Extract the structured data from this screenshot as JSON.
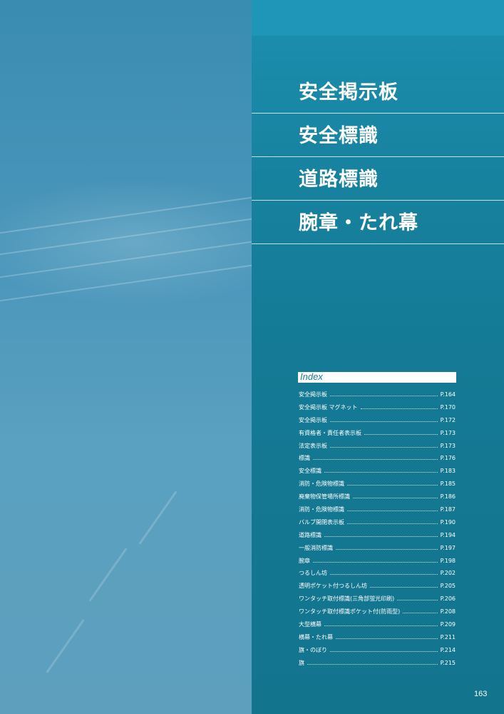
{
  "titles": [
    "安全掲示板",
    "安全標識",
    "道路標識",
    "腕章・たれ幕"
  ],
  "index": {
    "header": "Index",
    "items": [
      {
        "label": "安全掲示板",
        "page": "P.164"
      },
      {
        "label": "安全掲示板 マグネット",
        "page": "P.170"
      },
      {
        "label": "安全掲示板",
        "page": "P.172"
      },
      {
        "label": "有資格者・責任者表示板",
        "page": "P.173"
      },
      {
        "label": "法定表示板",
        "page": "P.173"
      },
      {
        "label": "標識",
        "page": "P.176"
      },
      {
        "label": "安全標識",
        "page": "P.183"
      },
      {
        "label": "消防・危険物標識",
        "page": "P.185"
      },
      {
        "label": "廃棄物保管場所標識",
        "page": "P.186"
      },
      {
        "label": "消防・危険物標識",
        "page": "P.187"
      },
      {
        "label": "バルブ開閉表示板",
        "page": "P.190"
      },
      {
        "label": "道路標識",
        "page": "P.194"
      },
      {
        "label": "一般消防標識",
        "page": "P.197"
      },
      {
        "label": "腕章",
        "page": "P.198"
      },
      {
        "label": "つるしん坊",
        "page": "P.202"
      },
      {
        "label": "透明ポケット付つるしん坊",
        "page": "P.205"
      },
      {
        "label": "ワンタッチ取付標識(三角部蛍光印刷)",
        "page": "P.206"
      },
      {
        "label": "ワンタッチ取付標識ポケット付(防雨型)",
        "page": "P.208"
      },
      {
        "label": "大型横幕",
        "page": "P.209"
      },
      {
        "label": "横幕・たれ幕",
        "page": "P.211"
      },
      {
        "label": "旗・のぼり",
        "page": "P.214"
      },
      {
        "label": "旗",
        "page": "P.215"
      }
    ]
  },
  "page_number": "163",
  "colors": {
    "left_panel": "#4b97bb",
    "right_panel": "#147a95",
    "accent_top": "#1f96b7"
  }
}
